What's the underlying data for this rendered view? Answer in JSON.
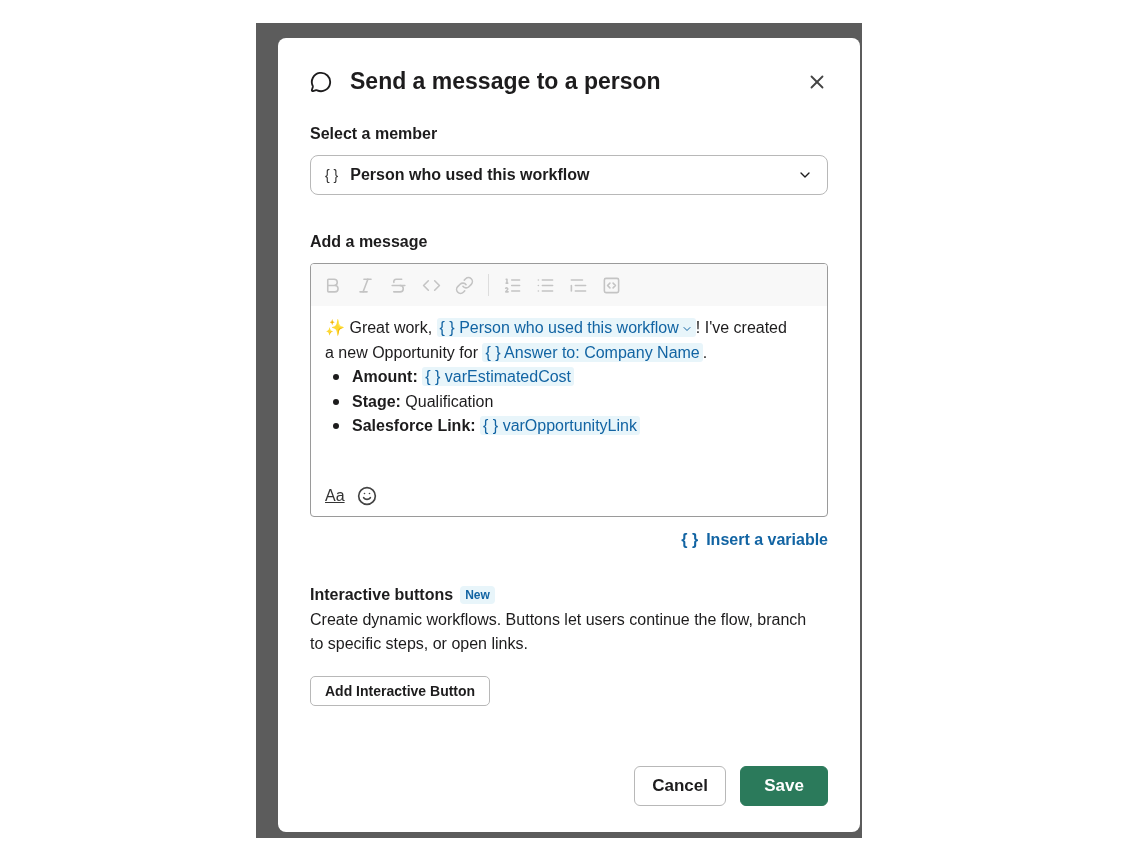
{
  "dialog": {
    "title": "Send a message to a person"
  },
  "member": {
    "label": "Select a member",
    "prefix": "{ }",
    "value": "Person who used this workflow"
  },
  "message": {
    "label": "Add a message",
    "paragraph": [
      {
        "kind": "text",
        "text": "✨ Great work, "
      },
      {
        "kind": "token",
        "text": "{ } Person who used this workflow",
        "dropdown": true
      },
      {
        "kind": "text",
        "text": "! I've created a new Opportunity for "
      },
      {
        "kind": "token",
        "text": "{ } Answer to: Company Name",
        "dropdown": false
      },
      {
        "kind": "text",
        "text": "."
      }
    ],
    "bullets": [
      {
        "label": "Amount:",
        "segments": [
          {
            "kind": "token",
            "text": "{ } varEstimatedCost",
            "dropdown": false
          }
        ]
      },
      {
        "label": "Stage:",
        "segments": [
          {
            "kind": "text",
            "text": "Qualification"
          }
        ]
      },
      {
        "label": "Salesforce Link:",
        "segments": [
          {
            "kind": "token",
            "text": "{ } varOpportunityLink",
            "dropdown": false
          }
        ]
      }
    ],
    "format_button": "Aa"
  },
  "insert_variable": {
    "prefix": "{ }",
    "label": "Insert a variable"
  },
  "interactive": {
    "heading": "Interactive buttons",
    "badge": "New",
    "description": "Create dynamic workflows. Buttons let users continue the flow, branch to specific steps, or open links.",
    "button": "Add Interactive Button"
  },
  "footer": {
    "cancel": "Cancel",
    "save": "Save"
  }
}
